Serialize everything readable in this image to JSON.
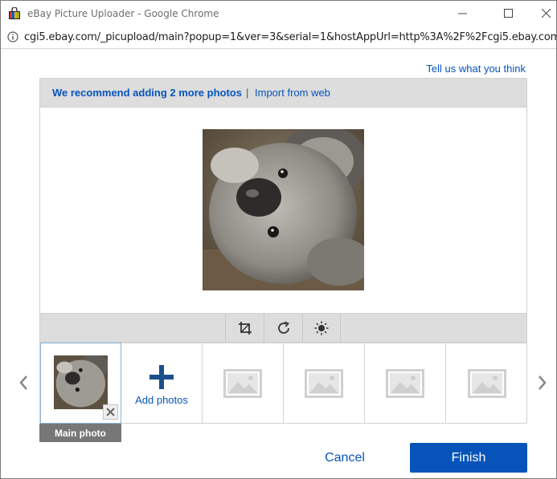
{
  "window": {
    "title": "eBay Picture Uploader - Google Chrome",
    "url": "cgi5.ebay.com/_picupload/main?popup=1&ver=3&serial=1&hostAppUrl=http%3A%2F%2Fcgi5.ebay.com",
    "icons": {
      "app": "ebay-shopping-bag-icon",
      "info": "info-icon",
      "minimize": "minimize-icon",
      "maximize": "maximize-icon",
      "close": "close-icon"
    }
  },
  "header": {
    "feedback_link": "Tell us what you think"
  },
  "recommend_bar": {
    "message": "We recommend adding 2 more photos",
    "separator": "|",
    "import_link": "Import from web"
  },
  "toolbar": {
    "tools": [
      {
        "name": "crop",
        "icon": "crop-icon"
      },
      {
        "name": "rotate",
        "icon": "rotate-icon"
      },
      {
        "name": "brightness",
        "icon": "brightness-icon"
      }
    ]
  },
  "strip": {
    "add_label": "Add photos",
    "main_label": "Main photo",
    "empty_slots": 4
  },
  "footer": {
    "cancel_label": "Cancel",
    "finish_label": "Finish"
  },
  "colors": {
    "link": "#0654ba",
    "primary_button": "#0654ba",
    "bar_background": "#dddddd",
    "main_label_background": "#777777"
  }
}
